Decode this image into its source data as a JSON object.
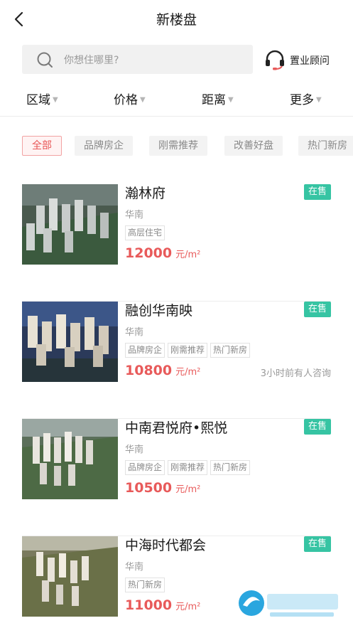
{
  "header": {
    "title": "新楼盘"
  },
  "search": {
    "placeholder": "你想住哪里?",
    "advisor_label": "置业顾问"
  },
  "filters": [
    {
      "label": "区域"
    },
    {
      "label": "价格"
    },
    {
      "label": "距离"
    },
    {
      "label": "更多"
    }
  ],
  "chips": [
    {
      "label": "全部",
      "active": true
    },
    {
      "label": "品牌房企",
      "active": false
    },
    {
      "label": "刚需推荐",
      "active": false
    },
    {
      "label": "改善好盘",
      "active": false
    },
    {
      "label": "热门新房",
      "active": false
    }
  ],
  "listings": [
    {
      "name": "瀚林府",
      "status": "在售",
      "region": "华南",
      "tags": [
        "高层住宅"
      ],
      "price": "12000",
      "unit": "元/m²",
      "note": ""
    },
    {
      "name": "融创华南映",
      "status": "在售",
      "region": "华南",
      "tags": [
        "品牌房企",
        "刚需推荐",
        "热门新房"
      ],
      "price": "10800",
      "unit": "元/m²",
      "note": "3小时前有人咨询"
    },
    {
      "name": "中南君悦府•熙悦",
      "status": "在售",
      "region": "华南",
      "tags": [
        "品牌房企",
        "刚需推荐",
        "热门新房"
      ],
      "price": "10500",
      "unit": "元/m²",
      "note": ""
    },
    {
      "name": "中海时代都会",
      "status": "在售",
      "region": "华南",
      "tags": [
        "热门新房"
      ],
      "price": "11000",
      "unit": "元/m²",
      "note": ""
    }
  ],
  "colors": {
    "accent_red": "#e85a5a",
    "status_green": "#36c4a3",
    "chip_bg": "#f3f3f3"
  },
  "icons": {
    "back": "chevron-left-icon",
    "search": "search-icon",
    "advisor": "headset-icon"
  }
}
